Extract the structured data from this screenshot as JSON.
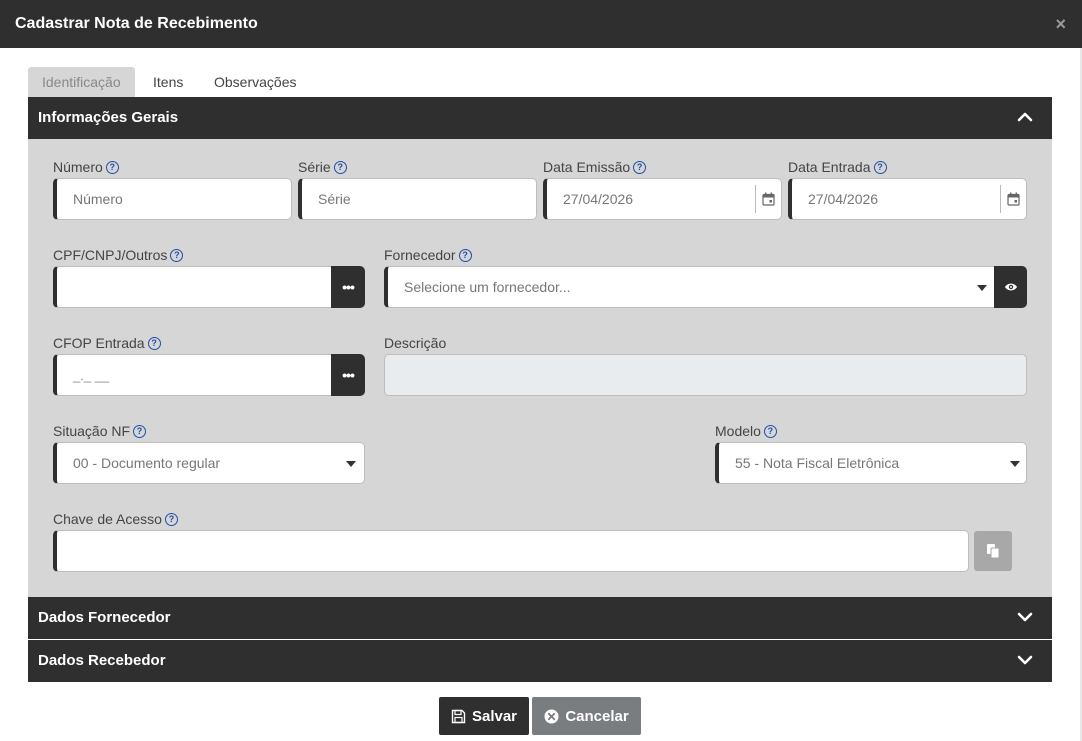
{
  "modal": {
    "title": "Cadastrar Nota de Recebimento",
    "close_glyph": "×"
  },
  "tabs": [
    {
      "label": "Identificação",
      "active": true
    },
    {
      "label": "Itens",
      "active": false
    },
    {
      "label": "Observações",
      "active": false
    }
  ],
  "panels": {
    "general": {
      "title": "Informações Gerais",
      "expanded": true
    },
    "supplier": {
      "title": "Dados Fornecedor",
      "expanded": false
    },
    "receiver": {
      "title": "Dados Recebedor",
      "expanded": false
    }
  },
  "form": {
    "numero": {
      "label": "Número",
      "placeholder": "Número",
      "value": ""
    },
    "serie": {
      "label": "Série",
      "placeholder": "Série",
      "value": ""
    },
    "data_emissao": {
      "label": "Data Emissão",
      "value": "27/04/2026",
      "icon": "calendar-icon"
    },
    "data_entrada": {
      "label": "Data Entrada",
      "value": "27/04/2026",
      "icon": "calendar-icon"
    },
    "cpf_cnpj": {
      "label": "CPF/CNPJ/Outros",
      "value": "",
      "button_glyph": "•••"
    },
    "fornecedor": {
      "label": "Fornecedor",
      "placeholder": "Selecione um fornecedor...",
      "icon": "eye-icon"
    },
    "cfop": {
      "label": "CFOP Entrada",
      "mask": "_._ __",
      "button_glyph": "•••"
    },
    "descricao": {
      "label": "Descrição",
      "value": ""
    },
    "situacao": {
      "label": "Situação NF",
      "selected": "00 - Documento regular"
    },
    "modelo": {
      "label": "Modelo",
      "selected": "55 - Nota Fiscal Eletrônica"
    },
    "chave": {
      "label": "Chave de Acesso",
      "value": "",
      "icon": "copy-icon"
    }
  },
  "help_glyph": "?",
  "actions": {
    "save_label": "Salvar",
    "cancel_label": "Cancelar"
  },
  "colors": {
    "header": "#2f2f2f",
    "panel_body": "#d6d6d6",
    "cancel": "#7a7d80",
    "help": "#1f4fa8"
  }
}
